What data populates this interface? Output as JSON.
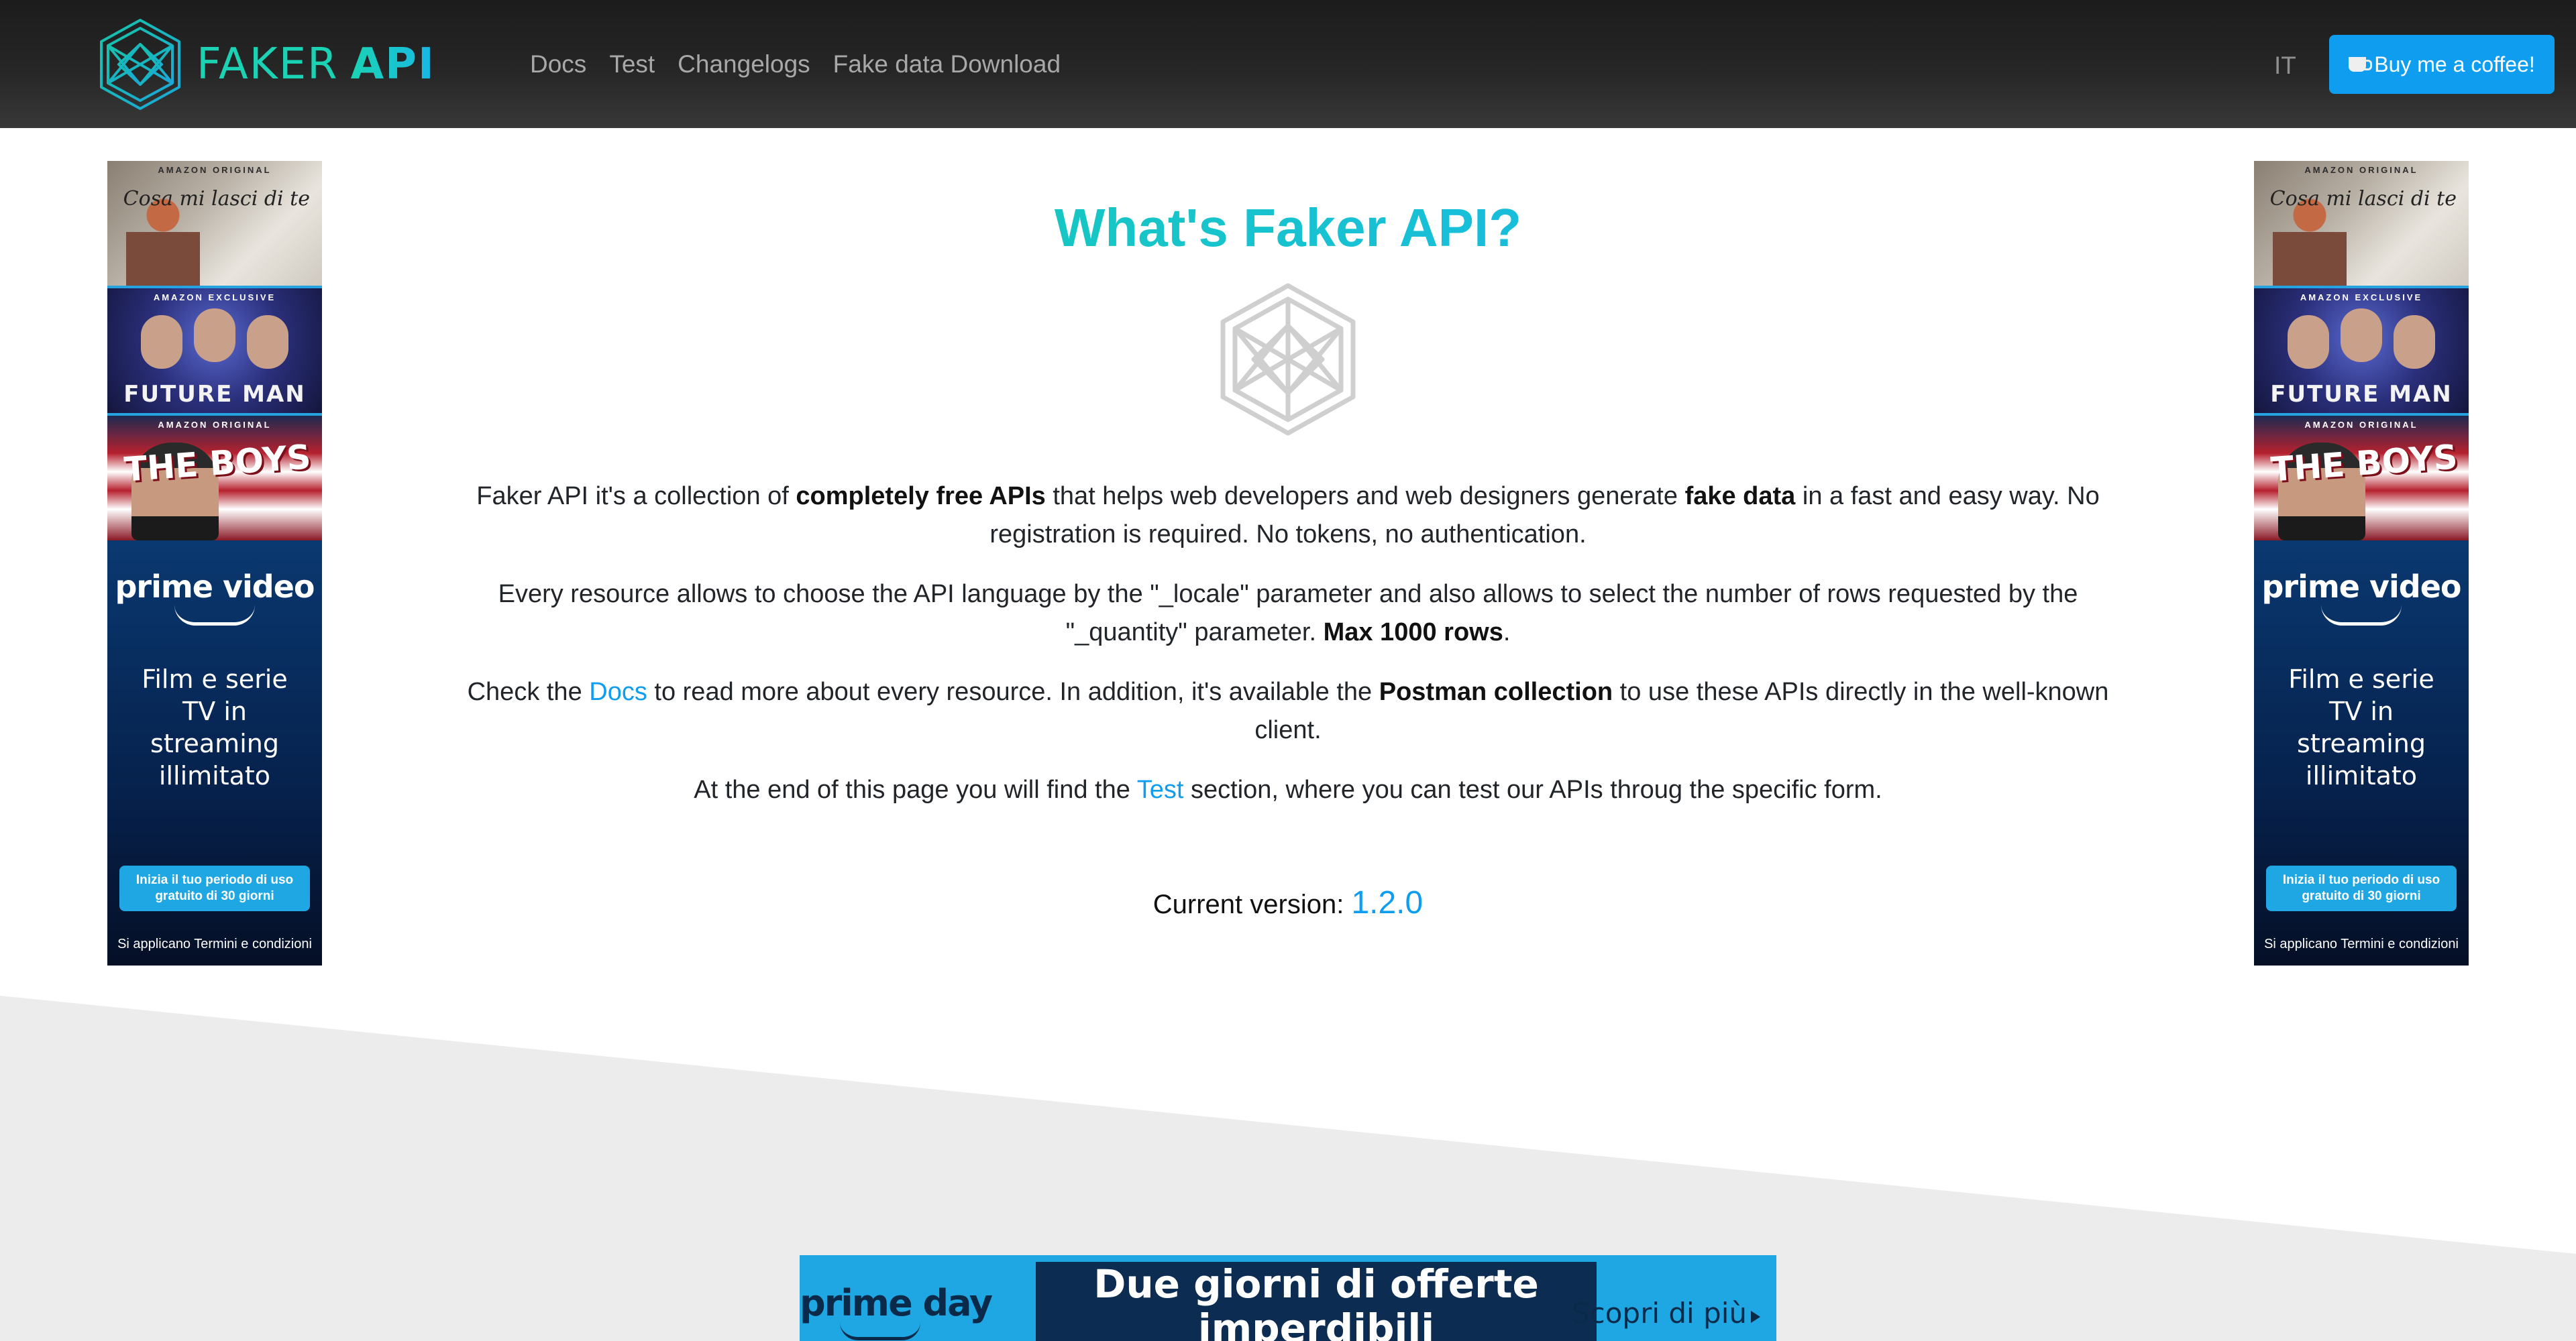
{
  "header": {
    "brand_word1": "FAKER",
    "brand_word2": "API",
    "nav": [
      "Docs",
      "Test",
      "Changelogs",
      "Fake data Download"
    ],
    "language": "IT",
    "coffee_label": "Buy me a coffee!"
  },
  "main": {
    "title": "What's Faker API?",
    "p1": {
      "t1": "Faker API it's a collection of ",
      "b1": "completely free APIs",
      "t2": " that helps web developers and web designers generate ",
      "b2": "fake data",
      "t3": " in a fast and easy way. No registration is required. No tokens, no authentication."
    },
    "p2": {
      "t1": "Every resource allows to choose the API language by the \"_locale\" parameter and also allows to select the number of rows requested by the \"_quantity\" parameter. ",
      "b1": "Max 1000 rows",
      "t2": "."
    },
    "p3": {
      "t1": "Check the ",
      "link": "Docs",
      "t2": " to read more about every resource. In addition, it's available the ",
      "b1": "Postman collection",
      "t3": " to use these APIs directly in the well-known client."
    },
    "p4": {
      "t1": "At the end of this page you will find the ",
      "link": "Test",
      "t2": " section, where you can test our APIs throug the specific form."
    },
    "version_label": "Current version: ",
    "version_number": "1.2.0"
  },
  "side_ad": {
    "tag1": "AMAZON ORIGINAL",
    "title1": "Cosa mi lasci di te",
    "tag2": "AMAZON EXCLUSIVE",
    "title2": "FUTURE MAN",
    "tag3": "AMAZON ORIGINAL",
    "title3": "THE BOYS",
    "brand": "prime video",
    "copy": "Film e serie TV in streaming illimitato",
    "cta": "Inizia il tuo periodo di uso gratuito di 30 giorni",
    "terms": "Si applicano Termini e condizioni"
  },
  "banner": {
    "brand": "prime day",
    "offer": "Due  giorni di offerte imperdibili",
    "cta": "Scopri di più"
  },
  "colors": {
    "accent_teal": "#1bd3b4",
    "accent_blue": "#0f9df0",
    "navbar_bg": "#262626",
    "slant_bg": "#ececec"
  },
  "icons": [
    "faker-cube-logo-icon",
    "coffee-cup-icon",
    "hero-cube-icon"
  ]
}
